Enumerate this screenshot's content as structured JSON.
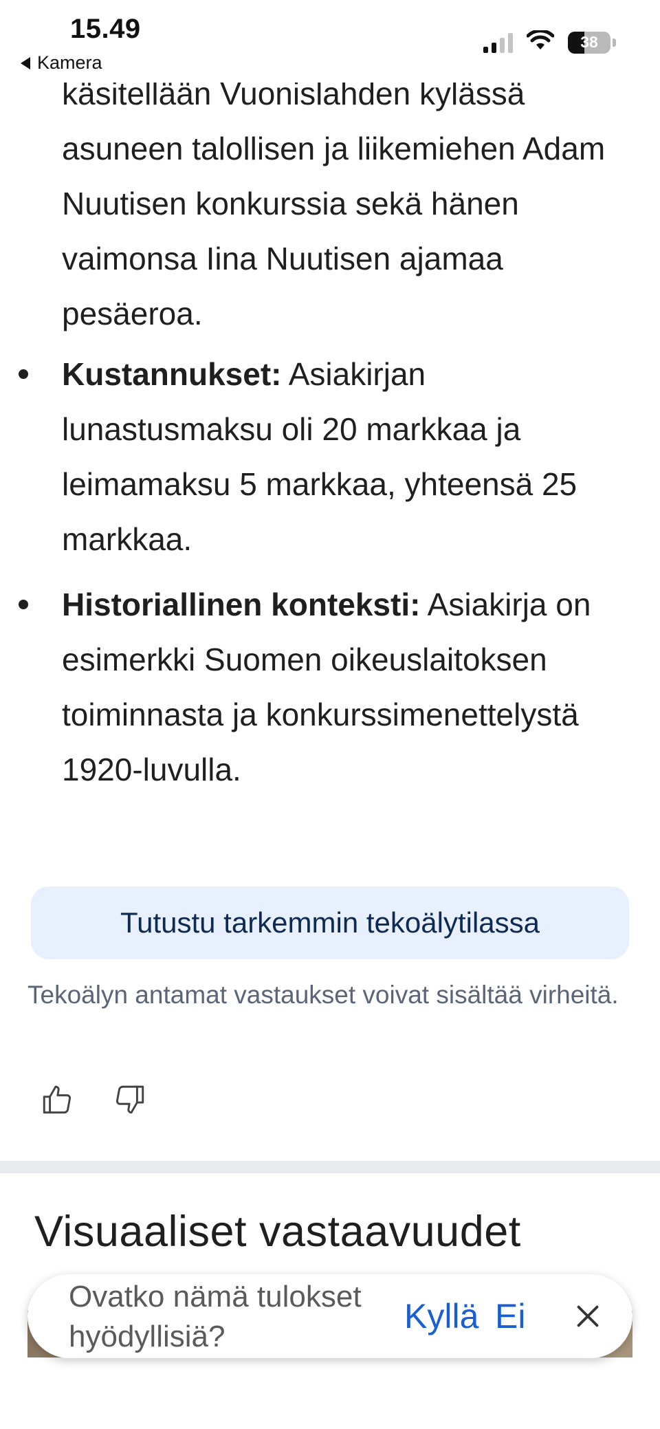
{
  "status_bar": {
    "time": "15.49",
    "back_label": "Kamera",
    "battery": "38"
  },
  "answer": {
    "paragraph_intro": "käsitellään Vuonislahden kylässä asuneen talollisen ja liikemiehen Adam Nuutisen konkurssia sekä hänen vaimonsa Iina Nuutisen ajamaa pesäeroa.",
    "bullets": [
      {
        "term": "Kustannukset:",
        "text": " Asiakirjan lunastusmaksu oli 20 markkaa ja leimamaksu 5 markkaa, yhteensä 25 markkaa."
      },
      {
        "term": "Historiallinen konteksti:",
        "text": " Asiakirja on esimerkki Suomen oikeuslaitoksen toiminnasta ja konkurssimenettelystä 1920-luvulla."
      }
    ]
  },
  "ai_mode_button": "Tutustu tarkemmin tekoälytilassa",
  "disclaimer": "Tekoälyn antamat vastaukset voivat sisältää virheitä.",
  "visual_section": {
    "title": "Visuaaliset vastaavuudet"
  },
  "feedback": {
    "question": "Ovatko nämä tulokset hyödyllisiä?",
    "yes": "Kyllä",
    "no": "Ei"
  },
  "icons": {
    "thumbs_up": "thumbs-up-icon",
    "thumbs_down": "thumbs-down-icon",
    "close": "close-icon"
  },
  "colors": {
    "ai_button_bg": "#e8effd",
    "link_blue": "#1a5fd0",
    "disclaimer_text": "#5c6478"
  }
}
